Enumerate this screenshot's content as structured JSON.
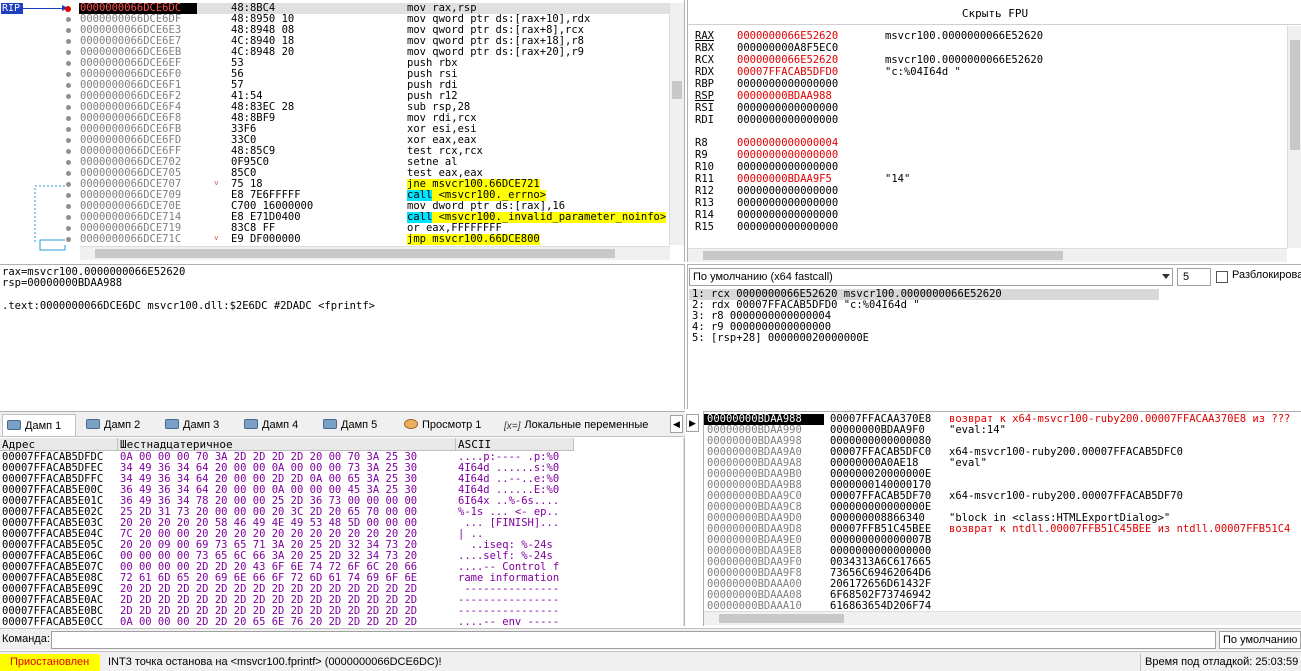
{
  "disasm": {
    "rip_label": "RIP",
    "rows": [
      {
        "addr": "0000000066DCE6DC",
        "bytes": "48:8BC4",
        "instr": "mov rax,rsp",
        "hl": "",
        "sel": true,
        "bp": "red",
        "arrow": ""
      },
      {
        "addr": "0000000066DCE6DF",
        "bytes": "48:8950 10",
        "instr": "mov qword ptr ds:[rax+10],rdx",
        "hl": "",
        "bp": "g",
        "arrow": ""
      },
      {
        "addr": "0000000066DCE6E3",
        "bytes": "48:8948 08",
        "instr": "mov qword ptr ds:[rax+8],rcx",
        "hl": "",
        "bp": "g",
        "arrow": ""
      },
      {
        "addr": "0000000066DCE6E7",
        "bytes": "4C:8940 18",
        "instr": "mov qword ptr ds:[rax+18],r8",
        "hl": "",
        "bp": "g",
        "arrow": ""
      },
      {
        "addr": "0000000066DCE6EB",
        "bytes": "4C:8948 20",
        "instr": "mov qword ptr ds:[rax+20],r9",
        "hl": "",
        "bp": "g",
        "arrow": ""
      },
      {
        "addr": "0000000066DCE6EF",
        "bytes": "53",
        "instr": "push rbx",
        "hl": "",
        "bp": "g",
        "arrow": ""
      },
      {
        "addr": "0000000066DCE6F0",
        "bytes": "56",
        "instr": "push rsi",
        "hl": "",
        "bp": "g",
        "arrow": ""
      },
      {
        "addr": "0000000066DCE6F1",
        "bytes": "57",
        "instr": "push rdi",
        "hl": "",
        "bp": "g",
        "arrow": ""
      },
      {
        "addr": "0000000066DCE6F2",
        "bytes": "41:54",
        "instr": "push r12",
        "hl": "",
        "bp": "g",
        "arrow": ""
      },
      {
        "addr": "0000000066DCE6F4",
        "bytes": "48:83EC 28",
        "instr": "sub rsp,28",
        "hl": "",
        "bp": "g",
        "arrow": ""
      },
      {
        "addr": "0000000066DCE6F8",
        "bytes": "48:8BF9",
        "instr": "mov rdi,rcx",
        "hl": "",
        "bp": "g",
        "arrow": ""
      },
      {
        "addr": "0000000066DCE6FB",
        "bytes": "33F6",
        "instr": "xor esi,esi",
        "hl": "",
        "bp": "g",
        "arrow": ""
      },
      {
        "addr": "0000000066DCE6FD",
        "bytes": "33C0",
        "instr": "xor eax,eax",
        "hl": "",
        "bp": "g",
        "arrow": ""
      },
      {
        "addr": "0000000066DCE6FF",
        "bytes": "48:85C9",
        "instr": "test rcx,rcx",
        "hl": "",
        "bp": "g",
        "arrow": ""
      },
      {
        "addr": "0000000066DCE702",
        "bytes": "0F95C0",
        "instr": "setne al",
        "hl": "",
        "bp": "g",
        "arrow": ""
      },
      {
        "addr": "0000000066DCE705",
        "bytes": "85C0",
        "instr": "test eax,eax",
        "hl": "",
        "bp": "g",
        "arrow": ""
      },
      {
        "addr": "0000000066DCE707",
        "bytes": "75 18",
        "instr": "jne msvcr100.66DCE721",
        "hl": "jne",
        "bp": "g",
        "arrow": "v"
      },
      {
        "addr": "0000000066DCE709",
        "bytes": "E8 7E6FFFFF",
        "instr": "call <msvcr100._errno>",
        "hl": "call",
        "bp": "g",
        "arrow": ""
      },
      {
        "addr": "0000000066DCE70E",
        "bytes": "C700 16000000",
        "instr": "mov dword ptr ds:[rax],16",
        "hl": "",
        "bp": "g",
        "arrow": ""
      },
      {
        "addr": "0000000066DCE714",
        "bytes": "E8 E71D0400",
        "instr": "call <msvcr100._invalid_parameter_noinfo>",
        "hl": "call",
        "bp": "g",
        "arrow": ""
      },
      {
        "addr": "0000000066DCE719",
        "bytes": "83C8 FF",
        "instr": "or eax,FFFFFFFF",
        "hl": "",
        "bp": "g",
        "arrow": ""
      },
      {
        "addr": "0000000066DCE71C",
        "bytes": "E9 DF000000",
        "instr": "jmp msvcr100.66DCE800",
        "hl": "jne",
        "bp": "g",
        "arrow": "v"
      }
    ]
  },
  "fpu_button": "Скрыть FPU",
  "registers": [
    {
      "name": "RAX",
      "val": "0000000066E52620",
      "comment": "msvcr100.0000000066E52620",
      "red": true,
      "ul": true
    },
    {
      "name": "RBX",
      "val": "000000000A8F5EC0",
      "comment": "",
      "red": false,
      "ul": false
    },
    {
      "name": "RCX",
      "val": "0000000066E52620",
      "comment": "msvcr100.0000000066E52620",
      "red": true,
      "ul": false
    },
    {
      "name": "RDX",
      "val": "00007FFACAB5DFD0",
      "comment": "\"c:%04I64d \"",
      "red": true,
      "ul": false
    },
    {
      "name": "RBP",
      "val": "0000000000000000",
      "comment": "",
      "red": false,
      "ul": false
    },
    {
      "name": "RSP",
      "val": "00000000BDAA988",
      "comment": "",
      "red": true,
      "ul": true
    },
    {
      "name": "RSI",
      "val": "0000000000000000",
      "comment": "",
      "red": false,
      "ul": false
    },
    {
      "name": "RDI",
      "val": "0000000000000000",
      "comment": "",
      "red": false,
      "ul": false
    },
    {
      "name": "R8",
      "val": "0000000000000004",
      "comment": "",
      "red": true,
      "ul": false,
      "gap": true
    },
    {
      "name": "R9",
      "val": "0000000000000000",
      "comment": "",
      "red": true,
      "ul": false
    },
    {
      "name": "R10",
      "val": "0000000000000000",
      "comment": "",
      "red": false,
      "ul": false
    },
    {
      "name": "R11",
      "val": "00000000BDAA9F5",
      "comment": "\"14\"",
      "red": true,
      "ul": false
    },
    {
      "name": "R12",
      "val": "0000000000000000",
      "comment": "",
      "red": false,
      "ul": false
    },
    {
      "name": "R13",
      "val": "0000000000000000",
      "comment": "",
      "red": false,
      "ul": false
    },
    {
      "name": "R14",
      "val": "0000000000000000",
      "comment": "",
      "red": false,
      "ul": false
    },
    {
      "name": "R15",
      "val": "0000000000000000",
      "comment": "",
      "red": false,
      "ul": false
    }
  ],
  "info": {
    "lines": [
      "rax=msvcr100.0000000066E52620",
      "rsp=00000000BDAA988",
      "",
      ".text:0000000066DCE6DC msvcr100.dll:$2E6DC #2DADC <fprintf>"
    ]
  },
  "callconv": {
    "select": "По умолчанию (x64 fastcall)",
    "spin": "5",
    "unlock": "Разблокировать",
    "lines": [
      "1: rcx 0000000066E52620 msvcr100.0000000066E52620",
      "2: rdx 00007FFACAB5DFD0 \"c:%04I64d \"",
      "3: r8 0000000000000004",
      "4: r9 0000000000000000",
      "5: [rsp+28] 000000020000000E"
    ]
  },
  "tabs": [
    {
      "label": "Дамп 1",
      "icon": "dump-icon",
      "active": true
    },
    {
      "label": "Дамп 2",
      "icon": "dump-icon"
    },
    {
      "label": "Дамп 3",
      "icon": "dump-icon"
    },
    {
      "label": "Дамп 4",
      "icon": "dump-icon"
    },
    {
      "label": "Дамп 5",
      "icon": "dump-icon"
    },
    {
      "label": "Просмотр 1",
      "icon": "watch-icon"
    },
    {
      "label": "Локальные переменные",
      "icon": "locals-icon",
      "prefix": "[x=]"
    }
  ],
  "dump": {
    "col_addr": "Адрес",
    "col_hex": "Шестнадцатеричное",
    "col_ascii": "ASCII",
    "rows": [
      {
        "addr": "00007FFACAB5DFDC",
        "hex": "0A 00 00 00 70 3A 2D 2D 2D 2D 20 00 70 3A 25 30",
        "ascii": "....p:---- .p:%0"
      },
      {
        "addr": "00007FFACAB5DFEC",
        "hex": "34 49 36 34 64 20 00 00 0A 00 00 00 73 3A 25 30",
        "ascii": "4I64d ......s:%0"
      },
      {
        "addr": "00007FFACAB5DFFC",
        "hex": "34 49 36 34 64 20 00 00 2D 2D 0A 00 65 3A 25 30",
        "ascii": "4I64d ..--..e:%0"
      },
      {
        "addr": "00007FFACAB5E00C",
        "hex": "36 49 36 34 64 20 00 00 0A 00 00 00 45 3A 25 30",
        "ascii": "4I64d ......E:%0"
      },
      {
        "addr": "00007FFACAB5E01C",
        "hex": "36 49 36 34 78 20 00 00 25 2D 36 73 00 00 00 00",
        "ascii": "6I64x ..%-6s...."
      },
      {
        "addr": "00007FFACAB5E02C",
        "hex": "25 2D 31 73 20 00 00 00 20 3C 2D 20 65 70 00 00",
        "ascii": "%-1s ... <- ep.."
      },
      {
        "addr": "00007FFACAB5E03C",
        "hex": "20 20 20 20 20 58 46 49 4E 49 53 48 5D 00 00 00",
        "ascii": " ... [FINISH]..."
      },
      {
        "addr": "00007FFACAB5E04C",
        "hex": "7C 20 00 00 20 20 20 20 20 20 20 20 20 20 20 20",
        "ascii": "| ..            "
      },
      {
        "addr": "00007FFACAB5E05C",
        "hex": "20 20 09 00 69 73 65 71 3A 20 25 2D 32 34 73 20",
        "ascii": "  ..iseq: %-24s "
      },
      {
        "addr": "00007FFACAB5E06C",
        "hex": "00 00 00 00 73 65 6C 66 3A 20 25 2D 32 34 73 20",
        "ascii": "....self: %-24s "
      },
      {
        "addr": "00007FFACAB5E07C",
        "hex": "00 00 00 00 2D 2D 20 43 6F 6E 74 72 6F 6C 20 66",
        "ascii": "....-- Control f"
      },
      {
        "addr": "00007FFACAB5E08C",
        "hex": "72 61 6D 65 20 69 6E 66 6F 72 6D 61 74 69 6F 6E",
        "ascii": "rame information"
      },
      {
        "addr": "00007FFACAB5E09C",
        "hex": "20 2D 2D 2D 2D 2D 2D 2D 2D 2D 2D 2D 2D 2D 2D 2D",
        "ascii": " ---------------"
      },
      {
        "addr": "00007FFACAB5E0AC",
        "hex": "2D 2D 2D 2D 2D 2D 2D 2D 2D 2D 2D 2D 2D 2D 2D 2D",
        "ascii": "----------------"
      },
      {
        "addr": "00007FFACAB5E0BC",
        "hex": "2D 2D 2D 2D 2D 2D 2D 2D 2D 2D 2D 2D 2D 2D 2D 2D",
        "ascii": "----------------"
      },
      {
        "addr": "00007FFACAB5E0CC",
        "hex": "0A 00 00 00 2D 2D 20 65 6E 76 20 2D 2D 2D 2D 2D",
        "ascii": "....-- env -----"
      }
    ]
  },
  "stack": {
    "rows": [
      {
        "addr": "00000000BDAA988",
        "val": "00007FFACAA370E8",
        "comment": "возврат к x64-msvcr100-ruby200.00007FFACAA370E8 из ???",
        "red": true,
        "sel": true
      },
      {
        "addr": "00000000BDAA990",
        "val": "00000000BDAA9F0",
        "comment": "\"eval:14\""
      },
      {
        "addr": "00000000BDAA998",
        "val": "0000000000000080",
        "comment": ""
      },
      {
        "addr": "00000000BDAA9A0",
        "val": "00007FFACAB5DFC0",
        "comment": "x64-msvcr100-ruby200.00007FFACAB5DFC0"
      },
      {
        "addr": "00000000BDAA9A8",
        "val": "00000000A0AE18",
        "comment": "\"eval\""
      },
      {
        "addr": "00000000BDAA9B0",
        "val": "000000020000000E",
        "comment": ""
      },
      {
        "addr": "00000000BDAA9B8",
        "val": "0000000140000170",
        "comment": ""
      },
      {
        "addr": "00000000BDAA9C0",
        "val": "00007FFACAB5DF70",
        "comment": "x64-msvcr100-ruby200.00007FFACAB5DF70"
      },
      {
        "addr": "00000000BDAA9C8",
        "val": "000000000000000E",
        "comment": ""
      },
      {
        "addr": "00000000BDAA9D0",
        "val": "000000008866340",
        "comment": "\"block in <class:HTMLExportDialog>\""
      },
      {
        "addr": "00000000BDAA9D8",
        "val": "00007FFB51C45BEE",
        "comment": "возврат к ntdll.00007FFB51C45BEE из ntdll.00007FFB51C4",
        "red": true
      },
      {
        "addr": "00000000BDAA9E0",
        "val": "000000000000007B",
        "comment": ""
      },
      {
        "addr": "00000000BDAA9E8",
        "val": "0000000000000000",
        "comment": ""
      },
      {
        "addr": "00000000BDAA9F0",
        "val": "0034313A6C617665",
        "comment": ""
      },
      {
        "addr": "00000000BDAA9F8",
        "val": "73656C69462064D6",
        "comment": ""
      },
      {
        "addr": "00000000BDAAA00",
        "val": "206172656D61432F",
        "comment": ""
      },
      {
        "addr": "00000000BDAAA08",
        "val": "6F68502F73746942",
        "comment": ""
      },
      {
        "addr": "00000000BDAAA10",
        "val": "616863654D206F74",
        "comment": ""
      }
    ]
  },
  "command": {
    "label": "Команда:",
    "value": "",
    "mode": "По умолчанию"
  },
  "status": {
    "state": "Приостановлен",
    "message": "INT3 точка останова на <msvcr100.fprintf> (0000000066DCE6DC)!",
    "time": "Время под отладкой: 25:03:59"
  }
}
